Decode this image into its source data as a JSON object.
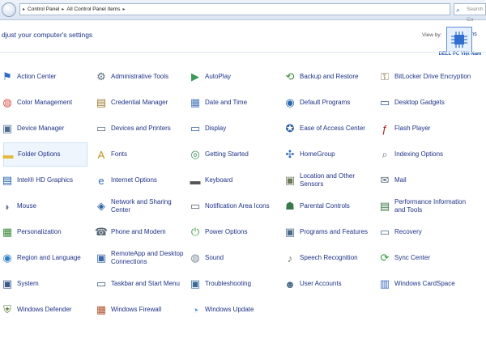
{
  "addressbar": {
    "crumbs": [
      "Control Panel",
      "All Control Panel Items"
    ],
    "search_placeholder": "Search Co"
  },
  "heading": "djust your computer's settings",
  "view_by": {
    "label": "View by:",
    "value": "Small icons"
  },
  "logo_text": "DELL PC Việt Nam",
  "columns": [
    [
      {
        "label": "Action Center",
        "icon": "flag-icon"
      },
      {
        "label": "Color Management",
        "icon": "color-management-icon"
      },
      {
        "label": "Device Manager",
        "icon": "device-manager-icon"
      },
      {
        "label": "Folder Options",
        "icon": "folder-icon",
        "selected": true
      },
      {
        "label": "Intel® HD Graphics",
        "icon": "intel-graphics-icon"
      },
      {
        "label": "Mouse",
        "icon": "mouse-icon"
      },
      {
        "label": "Personalization",
        "icon": "personalization-icon"
      },
      {
        "label": "Region and Language",
        "icon": "globe-icon"
      },
      {
        "label": "System",
        "icon": "system-icon"
      },
      {
        "label": "Windows Defender",
        "icon": "defender-icon"
      }
    ],
    [
      {
        "label": "Administrative Tools",
        "icon": "admin-tools-icon"
      },
      {
        "label": "Credential Manager",
        "icon": "credential-icon"
      },
      {
        "label": "Devices and Printers",
        "icon": "printer-icon"
      },
      {
        "label": "Fonts",
        "icon": "fonts-icon"
      },
      {
        "label": "Internet Options",
        "icon": "internet-options-icon"
      },
      {
        "label": "Network and Sharing Center",
        "icon": "network-icon"
      },
      {
        "label": "Phone and Modem",
        "icon": "phone-icon"
      },
      {
        "label": "RemoteApp and Desktop Connections",
        "icon": "remoteapp-icon"
      },
      {
        "label": "Taskbar and Start Menu",
        "icon": "taskbar-icon"
      },
      {
        "label": "Windows Firewall",
        "icon": "firewall-icon"
      }
    ],
    [
      {
        "label": "AutoPlay",
        "icon": "autoplay-icon"
      },
      {
        "label": "Date and Time",
        "icon": "calendar-icon"
      },
      {
        "label": "Display",
        "icon": "display-icon"
      },
      {
        "label": "Getting Started",
        "icon": "getting-started-icon"
      },
      {
        "label": "Keyboard",
        "icon": "keyboard-icon"
      },
      {
        "label": "Notification Area Icons",
        "icon": "notification-icon"
      },
      {
        "label": "Power Options",
        "icon": "power-icon"
      },
      {
        "label": "Sound",
        "icon": "speaker-icon"
      },
      {
        "label": "Troubleshooting",
        "icon": "troubleshooting-icon"
      },
      {
        "label": "Windows Update",
        "icon": "windows-update-icon"
      }
    ],
    [
      {
        "label": "Backup and Restore",
        "icon": "backup-icon"
      },
      {
        "label": "Default Programs",
        "icon": "default-programs-icon"
      },
      {
        "label": "Ease of Access Center",
        "icon": "ease-of-access-icon"
      },
      {
        "label": "HomeGroup",
        "icon": "homegroup-icon"
      },
      {
        "label": "Location and Other Sensors",
        "icon": "location-icon"
      },
      {
        "label": "Parental Controls",
        "icon": "parental-controls-icon"
      },
      {
        "label": "Programs and Features",
        "icon": "programs-icon"
      },
      {
        "label": "Speech Recognition",
        "icon": "microphone-icon"
      },
      {
        "label": "User Accounts",
        "icon": "user-accounts-icon"
      }
    ],
    [
      {
        "label": "BitLocker Drive Encryption",
        "icon": "bitlocker-icon"
      },
      {
        "label": "Desktop Gadgets",
        "icon": "gadgets-icon"
      },
      {
        "label": "Flash Player",
        "icon": "flash-icon"
      },
      {
        "label": "Indexing Options",
        "icon": "indexing-icon"
      },
      {
        "label": "Mail",
        "icon": "mail-icon"
      },
      {
        "label": "Performance Information and Tools",
        "icon": "performance-icon"
      },
      {
        "label": "Recovery",
        "icon": "recovery-icon"
      },
      {
        "label": "Sync Center",
        "icon": "sync-icon"
      },
      {
        "label": "Windows CardSpace",
        "icon": "cardspace-icon"
      }
    ]
  ],
  "colors": {
    "link": "#1e3287",
    "selected_bg": "#eef5fd",
    "address_bar": "#dbe5f2"
  }
}
